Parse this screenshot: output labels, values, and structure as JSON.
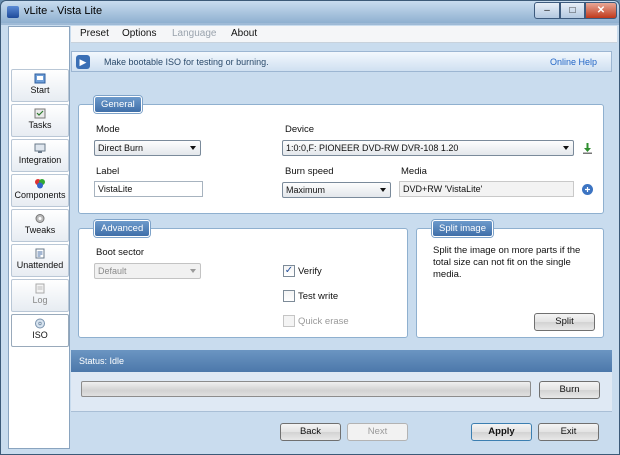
{
  "window": {
    "title": "vLite - Vista Lite"
  },
  "sidebar": {
    "items": [
      {
        "label": "Start",
        "icon": "start-icon"
      },
      {
        "label": "Tasks",
        "icon": "tasks-icon"
      },
      {
        "label": "Integration",
        "icon": "integration-icon"
      },
      {
        "label": "Components",
        "icon": "components-icon"
      },
      {
        "label": "Tweaks",
        "icon": "tweaks-icon"
      },
      {
        "label": "Unattended",
        "icon": "unattended-icon"
      },
      {
        "label": "Log",
        "icon": "log-icon",
        "disabled": true
      },
      {
        "label": "ISO",
        "icon": "iso-icon",
        "active": true
      }
    ]
  },
  "menu": {
    "preset": "Preset",
    "options": "Options",
    "language": "Language",
    "about": "About"
  },
  "banner": {
    "text": "Make bootable ISO for testing or burning.",
    "help": "Online Help"
  },
  "general": {
    "title": "General",
    "mode_label": "Mode",
    "mode_value": "Direct Burn",
    "device_label": "Device",
    "device_value": "1:0:0,F: PIONEER  DVD-RW  DVR-108  1.20",
    "label_label": "Label",
    "label_value": "VistaLite",
    "speed_label": "Burn speed",
    "speed_value": "Maximum",
    "media_label": "Media",
    "media_value": "DVD+RW 'VistaLite'"
  },
  "advanced": {
    "title": "Advanced",
    "boot_label": "Boot sector",
    "boot_value": "Default",
    "verify": "Verify",
    "test_write": "Test write",
    "quick_erase": "Quick erase",
    "verify_checked": true,
    "test_write_checked": false,
    "quick_erase_checked": false
  },
  "split": {
    "title": "Split image",
    "desc": "Split the image on more parts if the total size can not fit on the single media.",
    "button": "Split"
  },
  "status": {
    "text": "Status: Idle"
  },
  "progress": {
    "value": 0
  },
  "buttons": {
    "burn": "Burn",
    "back": "Back",
    "next": "Next",
    "apply": "Apply",
    "exit": "Exit"
  },
  "colors": {
    "accent": "#4c78aa",
    "group_title": "#3f6fa9",
    "link": "#2366c6"
  }
}
